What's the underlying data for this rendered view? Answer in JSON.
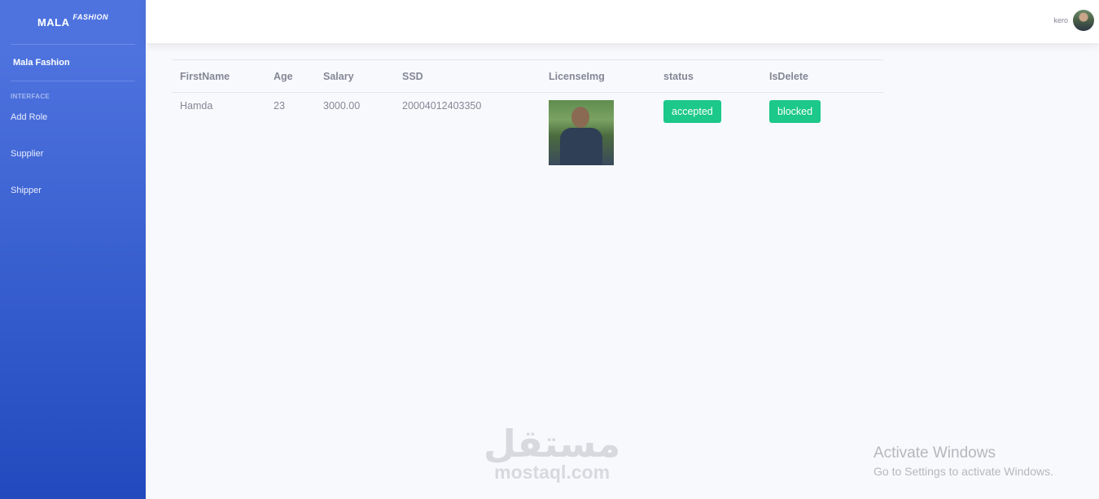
{
  "sidebar": {
    "brand_main": "MALA",
    "brand_sup": "FASHION",
    "active_item": "Mala Fashion",
    "heading": "INTERFACE",
    "items": [
      {
        "label": "Add Role"
      },
      {
        "label": "Supplier"
      },
      {
        "label": "Shipper"
      }
    ]
  },
  "topbar": {
    "username": "kero"
  },
  "table": {
    "headers": [
      "FirstName",
      "Age",
      "Salary",
      "SSD",
      "LicenseImg",
      "status",
      "IsDelete"
    ],
    "rows": [
      {
        "first_name": "Hamda",
        "age": "23",
        "salary": "3000.00",
        "ssd": "20004012403350",
        "status": "accepted",
        "is_delete": "blocked"
      }
    ]
  },
  "watermark": {
    "arabic": "مستقل",
    "latin": "mostaql.com"
  },
  "activate_windows": {
    "title": "Activate Windows",
    "subtitle": "Go to Settings to activate Windows."
  },
  "colors": {
    "sidebar_top": "#4e73df",
    "sidebar_bottom": "#224abe",
    "badge_success": "#1cc88a",
    "page_bg": "#f8f9fc"
  }
}
